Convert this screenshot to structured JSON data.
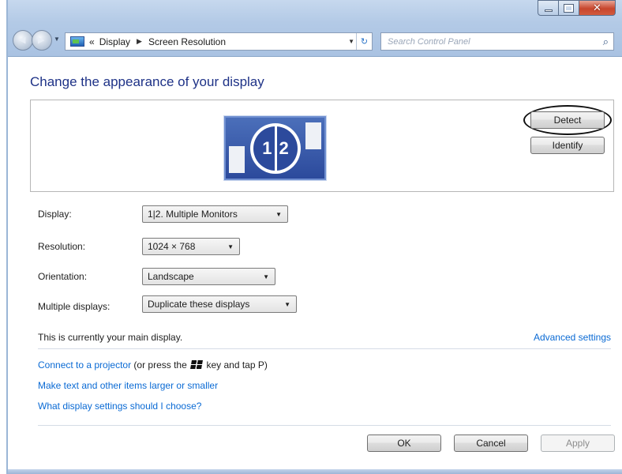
{
  "window": {
    "controls": {
      "minimize": "minimize",
      "maximize": "maximize",
      "close": "close"
    }
  },
  "nav": {
    "breadcrumb_prefix": "«",
    "breadcrumb": [
      "Display",
      "Screen Resolution"
    ],
    "search_placeholder": "Search Control Panel"
  },
  "main": {
    "title": "Change the appearance of your display",
    "monitor_labels": [
      "1",
      "2"
    ],
    "detect_label": "Detect",
    "identify_label": "Identify",
    "display_label": "Display:",
    "display_value": "1|2. Multiple Monitors",
    "resolution_label": "Resolution:",
    "resolution_value": "1024 × 768",
    "orientation_label": "Orientation:",
    "orientation_value": "Landscape",
    "multiple_displays_label": "Multiple displays:",
    "multiple_displays_value": "Duplicate these displays",
    "main_display_text": "This is currently your main display.",
    "advanced_link": "Advanced settings",
    "projector_link": "Connect to a projector",
    "projector_suffix_pre": "(or press the",
    "projector_suffix_post": "key and tap P)",
    "text_size_link": "Make text and other items larger or smaller",
    "which_settings_link": "What display settings should I choose?"
  },
  "footer": {
    "ok_label": "OK",
    "cancel_label": "Cancel",
    "apply_label": "Apply"
  },
  "icons": {
    "addr_icon": "display-icon",
    "search": "search-icon",
    "refresh": "refresh-icon",
    "windows_key": "windows-key-icon"
  }
}
